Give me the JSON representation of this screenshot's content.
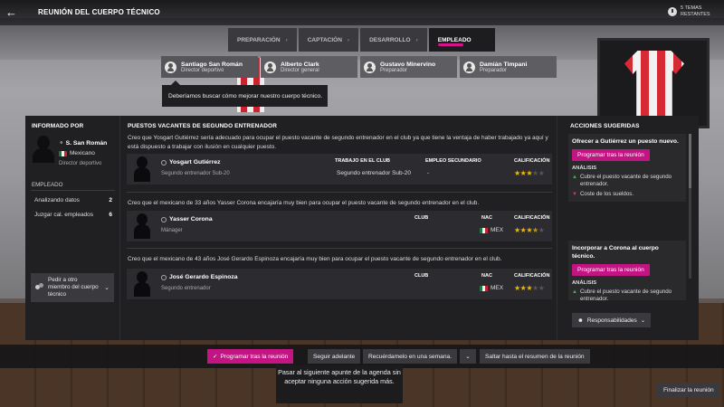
{
  "header": {
    "title": "REUNIÓN DEL CUERPO TÉCNICO",
    "back_icon": "back-arrow-icon",
    "topics_remaining": "5 TEMAS RESTANTES"
  },
  "stepper": [
    {
      "label": "PREPARACIÓN"
    },
    {
      "label": "CAPTACIÓN"
    },
    {
      "label": "DESARROLLO"
    },
    {
      "label": "EMPLEADO"
    }
  ],
  "participants": [
    {
      "name": "Santiago San Román",
      "role": "Director deportivo"
    },
    {
      "name": "Alberto Clark",
      "role": "Director general"
    },
    {
      "name": "Gustavo Minervino",
      "role": "Preparador"
    },
    {
      "name": "Damián Timpani",
      "role": "Preparador"
    }
  ],
  "speech": "Deberíamos buscar cómo mejorar nuestro cuerpo técnico.",
  "informed_by": {
    "heading": "INFORMADO POR",
    "name": "S. San Román",
    "nationality": "Mexicano",
    "role": "Director deportivo",
    "section": "EMPLEADO",
    "rows": [
      {
        "label": "Analizando datos",
        "value": "2"
      },
      {
        "label": "Juzgar cal. empleados",
        "value": "6"
      }
    ],
    "ask_button": "Pedir a otro miembro del cuerpo técnico"
  },
  "vacancies": {
    "heading": "PUESTOS VACANTES DE SEGUNDO ENTRENADOR",
    "items": [
      {
        "text": "Creo que Yosgart Gutiérrez sería adecuado para ocupar el puesto vacante de segundo entrenador en el club ya que tiene la ventaja de haber trabajado ya aquí y está dispuesto a trabajar con ilusión en cualquier puesto.",
        "name": "Yosgart Gutiérrez",
        "role": "Segundo entrenador Sub-20",
        "col1_label": "TRABAJO EN EL CLUB",
        "col1_value": "Segundo entrenador Sub-20",
        "col2_label": "EMPLEO SECUNDARIO",
        "col2_value": "-",
        "rating_label": "CALIFICACIÓN",
        "stars": 3
      },
      {
        "text": "Creo que el mexicano de 33 años Yasser Corona encajaría muy bien para ocupar el puesto vacante de segundo entrenador en el club.",
        "name": "Yasser Corona",
        "role": "Mánager",
        "col1_label": "CLUB",
        "col1_value": "",
        "col2_label": "NAC",
        "col2_value": "MEX",
        "rating_label": "CALIFICACIÓN",
        "stars": 3.5
      },
      {
        "text": "Creo que el mexicano de 43 años José Gerardo Espinoza encajaría muy bien para ocupar el puesto vacante de segundo entrenador en el club.",
        "name": "José Gerardo Espinoza",
        "role": "Segundo entrenador",
        "col1_label": "CLUB",
        "col1_value": "",
        "col2_label": "NAC",
        "col2_value": "MEX",
        "rating_label": "CALIFICACIÓN",
        "stars": 3
      }
    ]
  },
  "suggested": {
    "heading": "ACCIONES SUGERIDAS",
    "items": [
      {
        "title": "Ofrecer a Gutiérrez un puesto nuevo.",
        "button": "Programar tras la reunión",
        "analysis": "ANÁLISIS",
        "pros": [
          "Cubre el puesto vacante de segundo entrenador."
        ],
        "cons": [
          "Coste de los sueldos."
        ]
      },
      {
        "title": "Incorporar a Corona al cuerpo técnico.",
        "button": "Programar tras la reunión",
        "analysis": "ANÁLISIS",
        "pros": [
          "Cubre el puesto vacante de segundo entrenador."
        ],
        "cons": []
      }
    ],
    "responsibilities": "Responsabilidades"
  },
  "bottom": {
    "schedule": "Programar tras la reunión",
    "next": "Seguir adelante",
    "remind": "Recuérdamelo en una semana.",
    "skip": "Saltar hasta el resumen de la reunión",
    "tooltip": "Pasar al siguiente apunte de la agenda sin aceptar ninguna acción sugerida más.",
    "finalize": "Finalizar la reunión"
  },
  "colors": {
    "accent": "#c41382",
    "star": "#f2b900",
    "panel": "#202023"
  }
}
